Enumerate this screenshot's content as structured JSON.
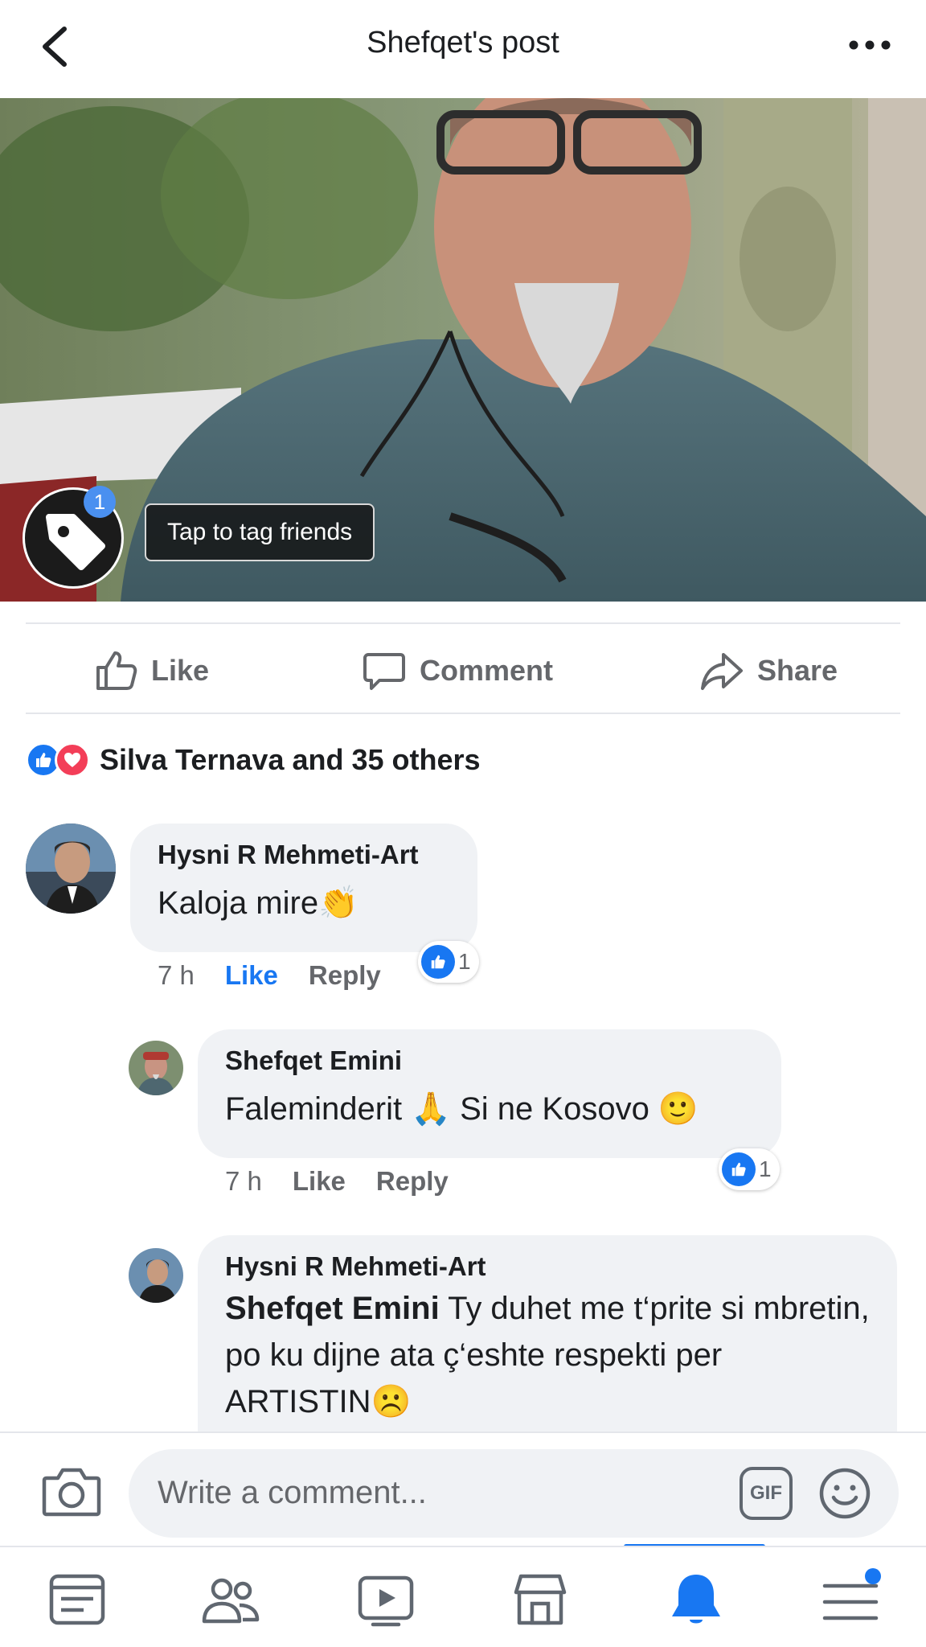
{
  "header": {
    "title": "Shefqet's post",
    "back_icon": "chevron-left-icon",
    "more_icon": "more-horizontal-icon"
  },
  "photo": {
    "tag_badge": "1",
    "tag_tooltip": "Tap to tag friends"
  },
  "actions": {
    "like": "Like",
    "comment": "Comment",
    "share": "Share"
  },
  "reactions": {
    "summary": "Silva Ternava and 35 others",
    "icons": [
      "like-reaction-icon",
      "love-reaction-icon"
    ]
  },
  "comments": [
    {
      "author": "Hysni R Mehmeti-Art",
      "text": "Kaloja mire👏",
      "time": "7 h",
      "like_label": "Like",
      "reply_label": "Reply",
      "reaction_count": "1",
      "liked": true
    },
    {
      "author": "Shefqet Emini",
      "text": "Faleminderit 🙏 Si ne Kosovo 🙂",
      "time": "7 h",
      "like_label": "Like",
      "reply_label": "Reply",
      "reaction_count": "1",
      "liked": false
    },
    {
      "author": "Hysni R Mehmeti-Art",
      "mention": "Shefqet Emini",
      "text": " Ty duhet me t‘prite si mbretin, po ku dijne ata ç‘eshte respekti per ARTISTIN☹️"
    }
  ],
  "composer": {
    "placeholder": "Write a comment...",
    "gif_label": "GIF"
  },
  "tabbar": {
    "tabs": [
      "news-feed-icon",
      "friends-icon",
      "watch-icon",
      "marketplace-icon",
      "notifications-icon",
      "menu-icon"
    ],
    "active_tab": "notifications-icon"
  },
  "colors": {
    "accent": "#1877f2",
    "love": "#f33e58",
    "bubble": "#f0f2f5",
    "secondary_text": "#65676b"
  }
}
